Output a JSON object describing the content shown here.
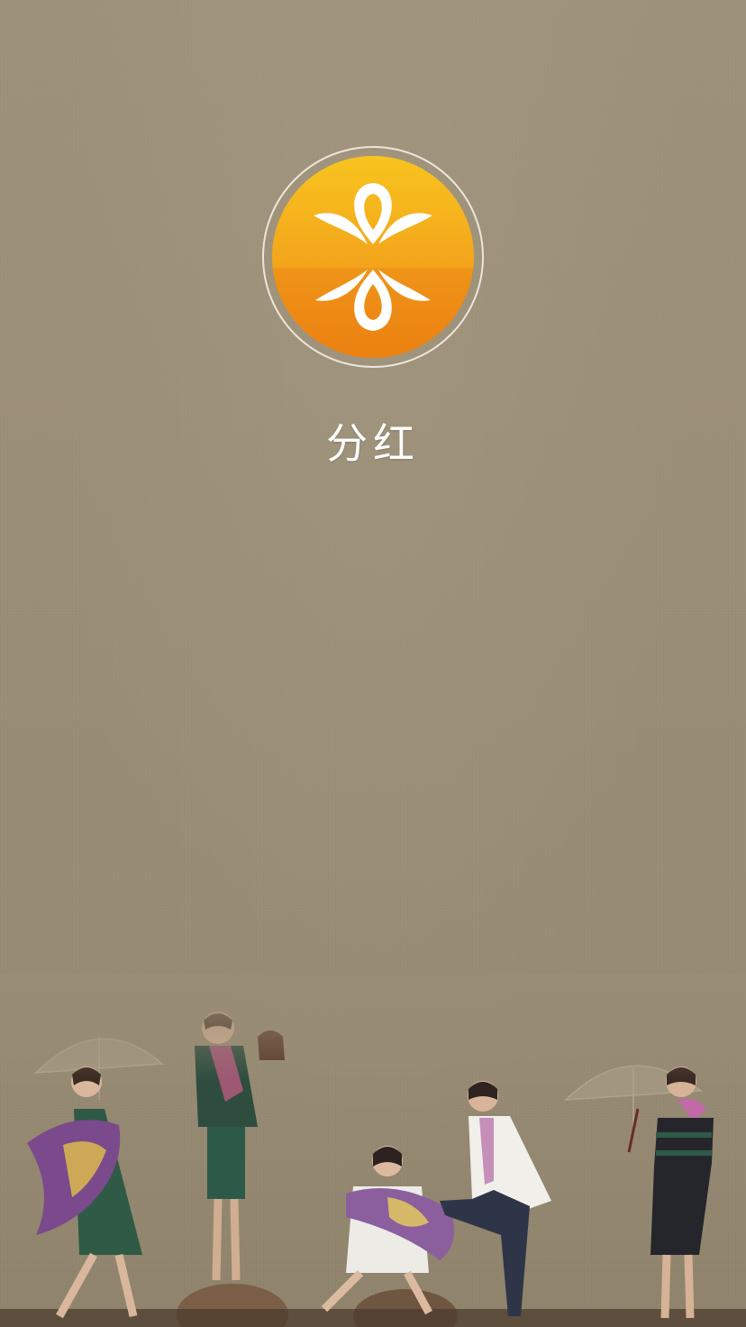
{
  "splash": {
    "app_name": "分红",
    "logo_icon": "ribbon-infinity-logo-icon",
    "colors": {
      "background": "#9c8f77",
      "logo_gradient_top": "#f8c21c",
      "logo_gradient_bottom": "#ee8412",
      "logo_glyph": "#ffffff",
      "title": "#ffffff"
    }
  }
}
